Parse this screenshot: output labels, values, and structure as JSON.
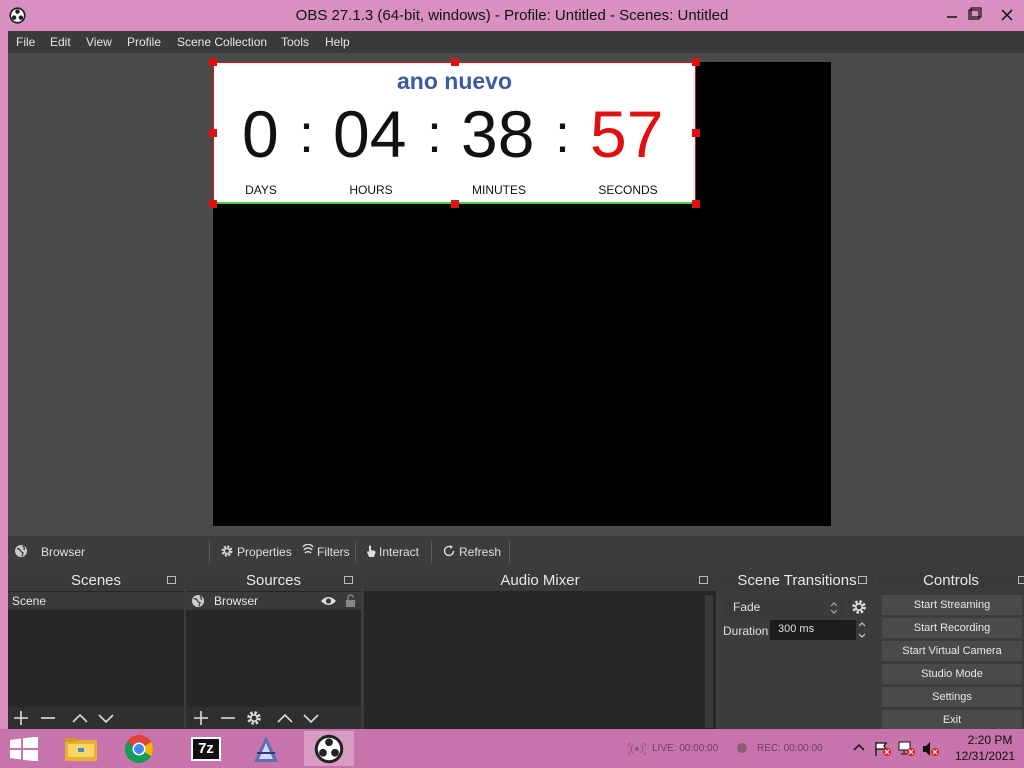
{
  "window": {
    "title": "OBS 27.1.3 (64-bit, windows) - Profile: Untitled - Scenes: Untitled",
    "frame_color": "#d98fc0"
  },
  "menu": [
    "File",
    "Edit",
    "View",
    "Profile",
    "Scene Collection",
    "Tools",
    "Help"
  ],
  "countdown": {
    "title": "ano nuevo",
    "days": "0",
    "hours": "04",
    "minutes": "38",
    "seconds": "57",
    "separator": ":",
    "labels": {
      "days": "DAYS",
      "hours": "HOURS",
      "minutes": "MINUTES",
      "seconds": "SECONDS"
    },
    "title_color": "#3d5a9b",
    "seconds_color": "#e01010"
  },
  "source_toolbar": {
    "source_name": "Browser",
    "properties": "Properties",
    "filters": "Filters",
    "interact": "Interact",
    "refresh": "Refresh"
  },
  "docks": {
    "scenes": {
      "title": "Scenes",
      "items": [
        "Scene"
      ]
    },
    "sources": {
      "title": "Sources",
      "items": [
        "Browser"
      ]
    },
    "audio_mixer": {
      "title": "Audio Mixer"
    },
    "scene_transitions": {
      "title": "Scene Transitions",
      "transition": "Fade",
      "duration_label": "Duration",
      "duration_value": "300 ms"
    },
    "controls": {
      "title": "Controls",
      "buttons": [
        "Start Streaming",
        "Start Recording",
        "Start Virtual Camera",
        "Studio Mode",
        "Settings",
        "Exit"
      ]
    }
  },
  "taskbar": {
    "live": "LIVE: 00:00:00",
    "rec": "REC: 00:00:00",
    "time": "2:20 PM",
    "date": "12/31/2021"
  }
}
